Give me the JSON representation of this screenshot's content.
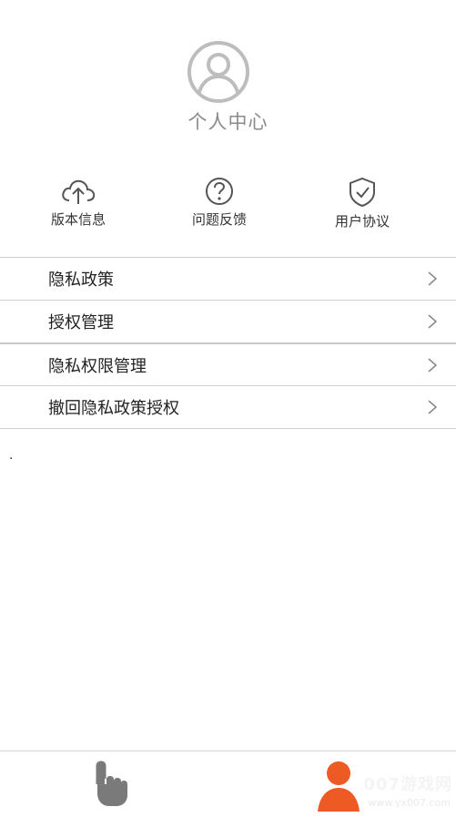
{
  "profile": {
    "title": "个人中心",
    "icon": "user-circle-icon"
  },
  "quick_actions": [
    {
      "label": "版本信息",
      "icon": "cloud-upload-icon"
    },
    {
      "label": "问题反馈",
      "icon": "question-circle-icon"
    },
    {
      "label": "用户协议",
      "icon": "shield-check-icon"
    }
  ],
  "menu": [
    {
      "label": "隐私政策"
    },
    {
      "label": "授权管理"
    },
    {
      "label": "隐私权限管理"
    },
    {
      "label": "撤回隐私政策授权"
    }
  ],
  "stray_text": ".",
  "bottom_nav": {
    "tabs": [
      {
        "icon": "touch-hand-icon",
        "color": "#7a7a7a"
      },
      {
        "icon": "person-icon",
        "color": "#ee5a24"
      }
    ]
  },
  "watermark": {
    "text": "007游戏网",
    "sub": "www.yx007.com"
  },
  "colors": {
    "accent": "#ee5a24",
    "icon_gray": "#bdbdbd",
    "text": "#333333"
  }
}
